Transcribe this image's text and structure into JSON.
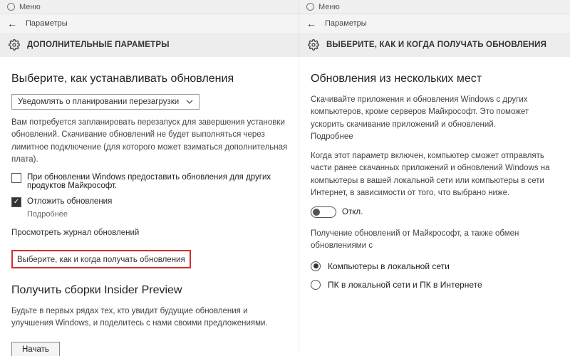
{
  "menu": {
    "label": "Меню"
  },
  "left": {
    "topbar_title": "Параметры",
    "header_title": "ДОПОЛНИТЕЛЬНЫЕ ПАРАМЕТРЫ",
    "section_install": "Выберите, как устанавливать обновления",
    "dropdown_value": "Уведомлять о планировании перезагрузки",
    "restart_text": "Вам потребуется запланировать перезапуск для завершения установки обновлений. Скачивание обновлений не будет выполняться через лимитное подключение (для которого может взиматься дополнительная плата).",
    "option_other_products": "При обновлении Windows предоставить обновления для других продуктов Майкрософт.",
    "option_defer": "Отложить обновления",
    "more": "Подробнее",
    "link_history": "Просмотреть журнал обновлений",
    "link_choose_when": "Выберите, как и когда получать обновления",
    "section_insider": "Получить сборки Insider Preview",
    "insider_text": "Будьте в первых рядах тех, кто увидит будущие обновления и улучшения Windows, и поделитесь с нами своими предложениями.",
    "start_button": "Начать"
  },
  "right": {
    "topbar_title": "Параметры",
    "header_title": "ВЫБЕРИТЕ, КАК И КОГДА ПОЛУЧАТЬ ОБНОВЛЕНИЯ",
    "section_multiple": "Обновления из нескольких мест",
    "desc1": "Скачивайте приложения и обновления Windows с других компьютеров, кроме серверов Майкрософт. Это поможет ускорить скачивание приложений и обновлений.",
    "more": "Подробнее",
    "desc2": "Когда этот параметр включен, компьютер сможет отправлять части ранее скачанных приложений и обновлений Windows на компьютеры в вашей локальной сети или компьютеры в сети Интернет, в зависимости от того, что выбрано ниже.",
    "toggle_label": "Откл.",
    "desc3": "Получение обновлений от Майкрософт, а также обмен обновлениями с",
    "radio_local": "Компьютеры в локальной сети",
    "radio_internet": "ПК в локальной сети и ПК в Интернете"
  }
}
